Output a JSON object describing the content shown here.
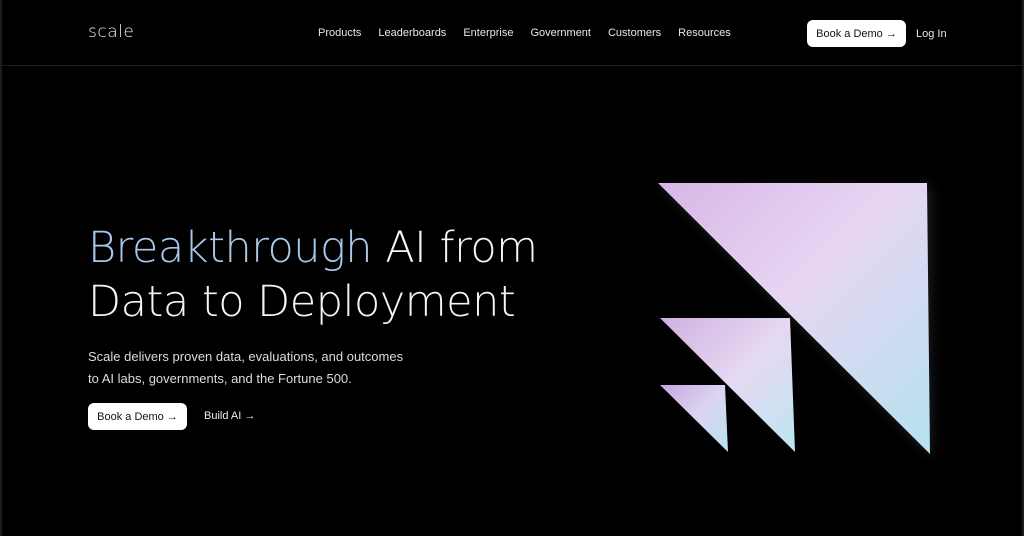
{
  "brand": {
    "logo_text": "scale"
  },
  "nav": {
    "links": [
      "Products",
      "Leaderboards",
      "Enterprise",
      "Government",
      "Customers",
      "Resources"
    ],
    "demo_button": "Book a Demo →",
    "login": "Log In"
  },
  "hero": {
    "title_accent": "Breakthrough",
    "title_rest_line1": " AI from",
    "title_line2": "Data to Deployment",
    "subtitle_line1": "Scale delivers proven data, evaluations, and outcomes",
    "subtitle_line2": "to AI labs, governments, and the Fortune 500.",
    "primary_cta": "Book a Demo →",
    "secondary_cta": "Build AI →"
  },
  "colors": {
    "background": "#000000",
    "accent_text": "#a9c9ea",
    "gradient_pink": "#dcbfe8",
    "gradient_blue": "#bfe8f2"
  },
  "icons": {
    "hero_graphic": "stacked-triangles-logo"
  }
}
